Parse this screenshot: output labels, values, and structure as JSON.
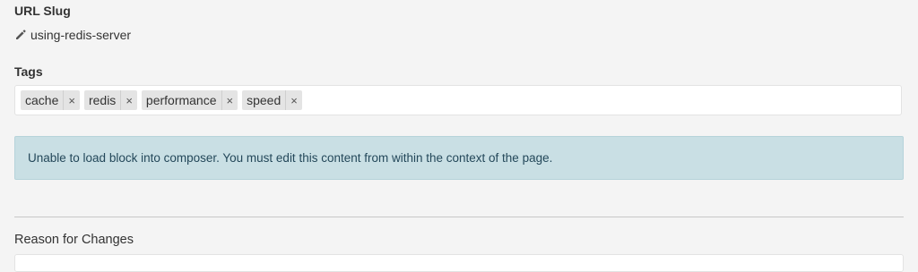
{
  "url_slug": {
    "label": "URL Slug",
    "icon": "pencil-icon",
    "value": "using-redis-server"
  },
  "tags": {
    "label": "Tags",
    "remove_symbol": "×",
    "items": [
      {
        "label": "cache"
      },
      {
        "label": "redis"
      },
      {
        "label": "performance"
      },
      {
        "label": "speed"
      }
    ]
  },
  "alert": {
    "message": "Unable to load block into composer. You must edit this content from within the context of the page.",
    "background": "#c9dfe4",
    "text_color": "#24485a"
  },
  "reason": {
    "label": "Reason for Changes",
    "value": ""
  }
}
